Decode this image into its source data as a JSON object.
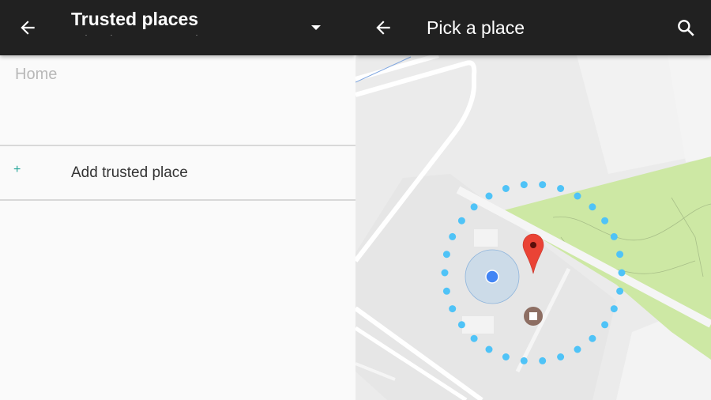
{
  "left_panel": {
    "appbar": {
      "back_icon": "arrow-left-icon",
      "title": "Trusted places",
      "dropdown_icon": "caret-down-icon"
    },
    "home_label": "Home",
    "add_place": {
      "icon": "plus-icon",
      "label": "Add trusted place",
      "accent_color": "#26a69a"
    }
  },
  "right_panel": {
    "appbar": {
      "back_icon": "arrow-left-icon",
      "title": "Pick a place",
      "search_icon": "search-icon"
    },
    "map": {
      "markers": [
        {
          "type": "current-location",
          "color": "#4285f4"
        },
        {
          "type": "selected-pin",
          "color": "#ea4335"
        },
        {
          "type": "place-marker",
          "color": "#8d6e63"
        }
      ],
      "radius_ring_color": "#4fc3f7",
      "park_color": "#cde8a4"
    }
  }
}
